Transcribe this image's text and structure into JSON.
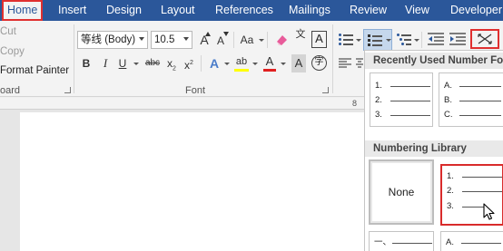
{
  "tabs": [
    {
      "label": "Home",
      "active": true
    },
    {
      "label": "Insert"
    },
    {
      "label": "Design"
    },
    {
      "label": "Layout"
    },
    {
      "label": "References"
    },
    {
      "label": "Mailings"
    },
    {
      "label": "Review"
    },
    {
      "label": "View"
    },
    {
      "label": "Developer"
    }
  ],
  "clipboard": {
    "cut": "Cut",
    "copy": "Copy",
    "format_painter": "Format Painter",
    "group_label": "oard"
  },
  "font": {
    "name": "等线 (Body)",
    "size": "10.5",
    "grow": "A",
    "shrink": "A",
    "change_case": "Aa",
    "bold": "B",
    "italic": "I",
    "underline": "U",
    "strike": "abc",
    "subscript": "x",
    "superscript": "x",
    "sub_mark": "2",
    "sup_mark": "2",
    "text_effects": "A",
    "highlight": "ab",
    "font_color": "A",
    "shade": "A",
    "enclose": "字",
    "char_border": "A",
    "phonetic": "文",
    "group_label": "Font",
    "colors": {
      "highlight": "#ffff00",
      "font_color": "#e02020"
    }
  },
  "ruler": {
    "marker": "8"
  },
  "numbering_panel": {
    "recent_header": "Recently Used Number Format",
    "library_header": "Numbering Library",
    "recent": [
      {
        "markers": [
          "1.",
          "2.",
          "3."
        ]
      },
      {
        "markers": [
          "A.",
          "B.",
          "C."
        ]
      }
    ],
    "library": [
      {
        "label": "None"
      },
      {
        "markers": [
          "1.",
          "2.",
          "3."
        ],
        "highlighted": true
      },
      {
        "markers": [
          "一、"
        ]
      },
      {
        "markers": [
          "A."
        ]
      }
    ],
    "highlight_color": "#d92b2b"
  }
}
